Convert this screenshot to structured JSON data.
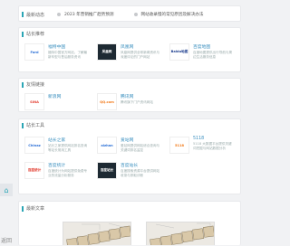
{
  "announcement": {
    "title": "最新动态",
    "items": [
      "2023 年营销推广趋势预测",
      "网站收录慢的常见原因及解决办法"
    ]
  },
  "recommend": {
    "title": "站长推荐",
    "cards": [
      {
        "name": "福特中国",
        "desc": "福特中国官方网站，了解最新车型与售后服务资讯",
        "logo": "Ford",
        "icon": "ford-logo"
      },
      {
        "name": "凤凰网",
        "desc": "凤凰网提供全球新闻资讯与深度评论的门户网站",
        "logo": "凤凰网",
        "icon": "ifeng-logo"
      },
      {
        "name": "百度地图",
        "desc": "百度地图提供出行导航与周边生活服务信息",
        "logo": "Baidu地图",
        "icon": "baidu-map-logo"
      }
    ]
  },
  "friend": {
    "title": "友情链接",
    "cards": [
      {
        "name": "新浪网",
        "desc": "",
        "logo": "SINA",
        "icon": "sina-logo"
      },
      {
        "name": "腾讯网",
        "desc": "腾讯旗下门户资讯网站",
        "logo": "QQ.com",
        "icon": "qq-logo"
      }
    ]
  },
  "tools": {
    "title": "站长工具",
    "cards": [
      {
        "name": "站长之家",
        "desc": "站长之家提供网站排名查询等站长常用工具",
        "logo": "Chinaz",
        "icon": "chinaz-logo"
      },
      {
        "name": "爱站网",
        "desc": "爱站网提供网站综合查询与关键词排名监控",
        "logo": "aizhan",
        "icon": "aizhan-logo"
      },
      {
        "name": "5118",
        "desc": "5118 大数据平台提供关键词挖掘与网站数据分析",
        "logo": "5118",
        "icon": "5118-logo"
      },
      {
        "name": "百度统计",
        "desc": "百度统计为网站提供免费专业的流量分析服务",
        "logo": "百度统计",
        "icon": "baidu-tongji-logo"
      },
      {
        "name": "百度站长",
        "desc": "百度搜索资源平台提供网站收录与抓取诊断",
        "logo": "百度站长",
        "icon": "baidu-ziyuan-logo"
      }
    ]
  },
  "news": {
    "title": "最新文章"
  },
  "sidebar": {
    "top_icon": "home-icon",
    "bottom_label": "返回",
    "bottom_sub": "顶部"
  }
}
